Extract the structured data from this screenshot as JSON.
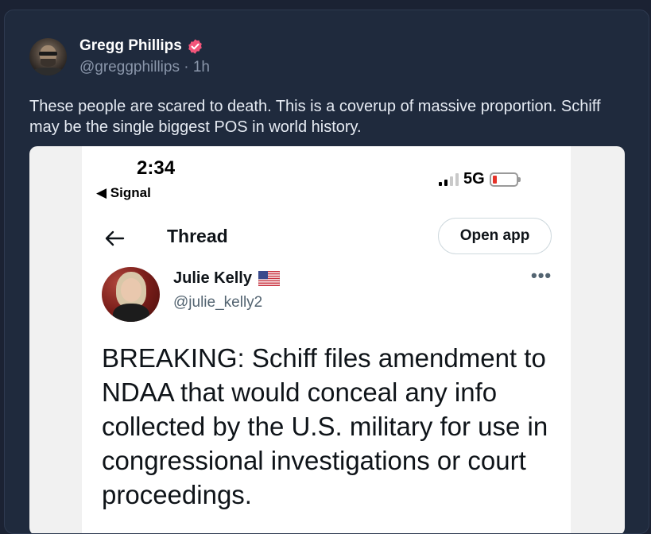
{
  "post": {
    "author_name": "Gregg Phillips",
    "handle_time": "@greggphillips · 1h",
    "text": "These people are scared to death. This is a coverup of massive proportion. Schiff may be the single biggest POS in world history."
  },
  "screenshot": {
    "status_time": "2:34",
    "status_back": "◀ Signal",
    "network": "5G",
    "thread_title": "Thread",
    "open_app_label": "Open app",
    "tweet_author": "Julie Kelly",
    "tweet_handle": "@julie_kelly2",
    "more_label": "•••",
    "tweet_text": "BREAKING: Schiff files amendment to NDAA that would conceal any info collected by the U.S. military for use in congressional investigations or court proceedings."
  },
  "colors": {
    "verified_badge": "#f2557a",
    "battery_low": "#e5332a"
  },
  "icons": {
    "verified": "verified-badge-icon",
    "back": "arrow-left-icon",
    "flag": "us-flag-icon"
  }
}
